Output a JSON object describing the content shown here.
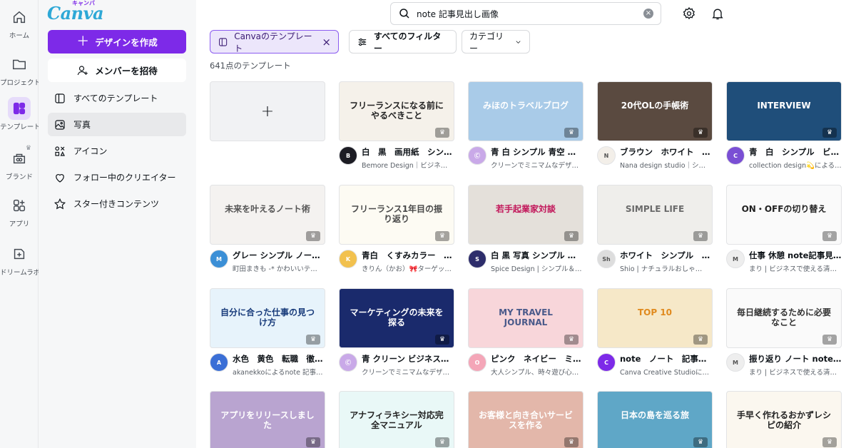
{
  "rail": [
    {
      "label": "ホーム",
      "icon": "home-icon"
    },
    {
      "label": "プロジェクト",
      "icon": "folder-icon"
    },
    {
      "label": "テンプレート",
      "icon": "template-icon"
    },
    {
      "label": "ブランド",
      "icon": "brand-icon"
    },
    {
      "label": "アプリ",
      "icon": "apps-icon"
    },
    {
      "label": "ドリームラボ",
      "icon": "dream-lab-icon"
    }
  ],
  "sidebar": {
    "logo": "Canva",
    "logo_sub": "キャンバ",
    "create_label": "デザインを作成",
    "invite_label": "メンバーを招待",
    "nav": [
      {
        "label": "すべてのテンプレート",
        "icon": "all-templates-icon"
      },
      {
        "label": "写真",
        "icon": "photo-icon"
      },
      {
        "label": "アイコン",
        "icon": "shapes-icon"
      },
      {
        "label": "フォロー中のクリエイター",
        "icon": "heart-icon"
      },
      {
        "label": "スター付きコンテンツ",
        "icon": "star-icon"
      }
    ]
  },
  "search": {
    "value": "note 記事見出し画像"
  },
  "filters": {
    "canva_templates": "Canvaのテンプレート",
    "all_filters": "すべてのフィルター",
    "category": "カテゴリー"
  },
  "count_label": "641点のテンプレート",
  "cards": [
    {
      "title": "白　黒　画用紙　シン…",
      "sub": "Bemore Design｜ビジネ…",
      "thumb_text": "フリーランスになる前にやるべきこと",
      "bg": "#f5f1ea",
      "fg": "#222222",
      "avatar_bg": "#1c1c24",
      "avatar_text": "B"
    },
    {
      "title": "青 白 シンプル 青空 ブ…",
      "sub": "クリーンでミニマムなデザ…",
      "thumb_text": "みほのトラベルブログ",
      "bg": "#a9cbe8",
      "fg": "#ffffff",
      "avatar_bg": "#c9a9e8",
      "avatar_text": "Ⓒ"
    },
    {
      "title": "ブラウン　ホワイト　…",
      "sub": "Nana design studio｜シ…",
      "thumb_text": "20代OLの手帳術",
      "bg": "#5a4a40",
      "fg": "#ffffff",
      "avatar_bg": "#f3efe9",
      "avatar_text": "N"
    },
    {
      "title": "青　白　シンプル　ビ…",
      "sub": "collection design💫による n…",
      "thumb_text": "INTERVIEW",
      "bg": "#1f4e7a",
      "fg": "#ffffff",
      "avatar_bg": "#7a4fd4",
      "avatar_text": "C"
    },
    {
      "title": "グレー シンプル ノー…",
      "sub": "町田まきも -* かわいいテ…",
      "thumb_text": "未来を叶えるノート術",
      "bg": "#f4f2f0",
      "fg": "#555555",
      "avatar_bg": "#3b8fd6",
      "avatar_text": "M"
    },
    {
      "title": "青白　くすみカラー　…",
      "sub": "きりん（かお）🎀ターゲッ…",
      "thumb_text": "フリーランス1年目の振り返り",
      "bg": "#fdfbf3",
      "fg": "#4a4a4a",
      "avatar_bg": "#f2c14e",
      "avatar_text": "K"
    },
    {
      "title": "白 黒 写真 シンプル 対…",
      "sub": "Spice Design | シンプル＆…",
      "thumb_text": "若手起業家対談",
      "bg": "#e4e0da",
      "fg": "#c2185b",
      "avatar_bg": "#2d2d6b",
      "avatar_text": "S"
    },
    {
      "title": "ホワイト　シンプル　…",
      "sub": "Shio | ナチュラルおしゃ…",
      "thumb_text": "SIMPLE LIFE",
      "bg": "#efeeeb",
      "fg": "#6a6a6a",
      "avatar_bg": "#dddddd",
      "avatar_text": "Sh"
    },
    {
      "title": "仕事 休憩 note記事見…",
      "sub": "まり | ビジネスで使える清…",
      "thumb_text": "ON・OFFの切り替え",
      "bg": "#fafafa",
      "fg": "#222222",
      "avatar_bg": "#eeeeee",
      "avatar_text": "M"
    },
    {
      "title": "水色　黄色　転職　徹…",
      "sub": "akanekkoによるnote 記事…",
      "thumb_text": "自分に合った仕事の見つけ方",
      "bg": "#e7f3fb",
      "fg": "#173a7a",
      "avatar_bg": "#3b6fd6",
      "avatar_text": "A"
    },
    {
      "title": "青 クリーン ビジネス…",
      "sub": "クリーンでミニマムなデザ…",
      "thumb_text": "マーケティングの未来を探る",
      "bg": "#1a2a6c",
      "fg": "#ffffff",
      "avatar_bg": "#c9a9e8",
      "avatar_text": "Ⓒ"
    },
    {
      "title": "ピンク　ネイビー　ミ…",
      "sub": "大人シンプル、時々遊び心…",
      "thumb_text": "MY TRAVEL JOURNAL",
      "bg": "#f8d6da",
      "fg": "#4a5a8a",
      "avatar_bg": "#f4a6b8",
      "avatar_text": "O"
    },
    {
      "title": "note　ノート　記事…",
      "sub": "Canva Creative Studioに…",
      "thumb_text": "TOP 10",
      "bg": "#f6e8c8",
      "fg": "#e08a1e",
      "avatar_bg": "#7d2ae8",
      "avatar_text": "C"
    },
    {
      "title": "振り返り ノート note…",
      "sub": "まり | ビジネスで使える清…",
      "thumb_text": "毎日継続するために必要なこと",
      "bg": "#fafafa",
      "fg": "#333333",
      "avatar_bg": "#eeeeee",
      "avatar_text": "M"
    },
    {
      "title": "",
      "sub": "",
      "thumb_text": "アプリをリリースしました",
      "bg": "#b9a4d0",
      "fg": "#ffffff"
    },
    {
      "title": "",
      "sub": "",
      "thumb_text": "アナフィラキシー対応完全マニュアル",
      "bg": "#e9f8f7",
      "fg": "#222222"
    },
    {
      "title": "",
      "sub": "",
      "thumb_text": "お客様と向き合いサービスを作る",
      "bg": "#e3b7aa",
      "fg": "#ffffff"
    },
    {
      "title": "",
      "sub": "",
      "thumb_text": "日本の島を巡る旅",
      "bg": "#5fa7c7",
      "fg": "#ffffff"
    },
    {
      "title": "",
      "sub": "",
      "thumb_text": "手早く作れるおかずレシピの紹介",
      "bg": "#fbf7ef",
      "fg": "#222222"
    }
  ]
}
